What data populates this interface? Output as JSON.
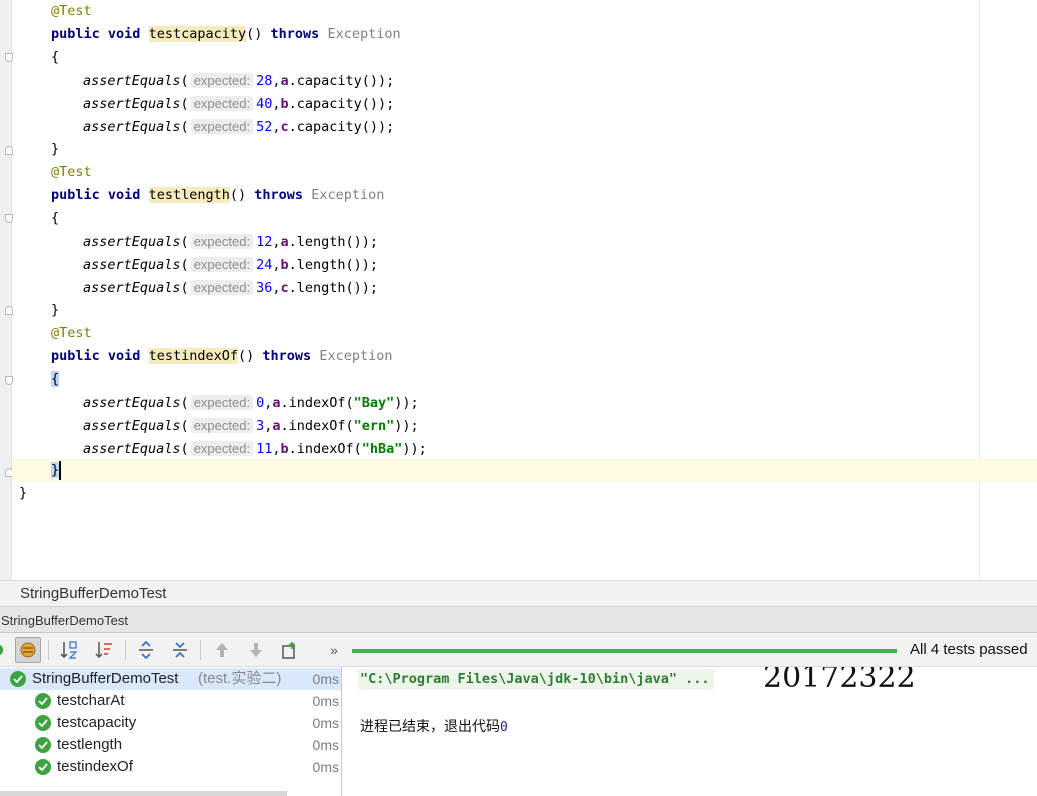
{
  "editor": {
    "lines": {
      "l0": {
        "annotation": "@Test"
      },
      "l1": {
        "public": "public",
        "void": "void",
        "method": "testcapacity",
        "paren": "()",
        "throws": "throws",
        "exception": "Exception"
      },
      "l2": {
        "brace": "{"
      },
      "l3": {
        "call": "assertEquals",
        "open": "(",
        "hint": "expected:",
        "value": "28",
        "obj": "a",
        "rest": ".capacity());"
      },
      "l4": {
        "call": "assertEquals",
        "open": "(",
        "hint": "expected:",
        "value": "40",
        "obj": "b",
        "rest": ".capacity());"
      },
      "l5": {
        "call": "assertEquals",
        "open": "(",
        "hint": "expected:",
        "value": "52",
        "obj": "c",
        "rest": ".capacity());"
      },
      "l6": {
        "brace": "}"
      },
      "l7": {
        "annotation": "@Test"
      },
      "l8": {
        "public": "public",
        "void": "void",
        "method": "testlength",
        "paren": "()",
        "throws": "throws",
        "exception": "Exception"
      },
      "l9": {
        "brace": "{"
      },
      "l10": {
        "call": "assertEquals",
        "open": "(",
        "hint": "expected:",
        "value": "12",
        "obj": "a",
        "rest": ".length());"
      },
      "l11": {
        "call": "assertEquals",
        "open": "(",
        "hint": "expected:",
        "value": "24",
        "obj": "b",
        "rest": ".length());"
      },
      "l12": {
        "call": "assertEquals",
        "open": "(",
        "hint": "expected:",
        "value": "36",
        "obj": "c",
        "rest": ".length());"
      },
      "l13": {
        "brace": "}"
      },
      "l14": {
        "annotation": "@Test"
      },
      "l15": {
        "public": "public",
        "void": "void",
        "method": "testindexOf",
        "paren": "()",
        "throws": "throws",
        "exception": "Exception"
      },
      "l16": {
        "brace": "{"
      },
      "l17": {
        "call": "assertEquals",
        "open": "(",
        "hint": "expected:",
        "value": "0",
        "obj": "a",
        "mid": ".indexOf(",
        "str": "\"Bay\"",
        "close": "));"
      },
      "l18": {
        "call": "assertEquals",
        "open": "(",
        "hint": "expected:",
        "value": "3",
        "obj": "a",
        "mid": ".indexOf(",
        "str": "\"ern\"",
        "close": "));"
      },
      "l19": {
        "call": "assertEquals",
        "open": "(",
        "hint": "expected:",
        "value": "11",
        "obj": "b",
        "mid": ".indexOf(",
        "str": "\"hBa\"",
        "close": "));"
      },
      "l20": {
        "brace": "}"
      },
      "l21": {
        "brace": "}"
      }
    }
  },
  "run": {
    "header_title": "StringBufferDemoTest",
    "tab_label": "StringBufferDemoTest",
    "more_label": "»",
    "status": "All 4 tests passed"
  },
  "tree": {
    "root": {
      "name": "StringBufferDemoTest",
      "sub": "(test.实验二)",
      "time": "0ms"
    },
    "items": [
      {
        "name": "testcharAt",
        "time": "0ms"
      },
      {
        "name": "testcapacity",
        "time": "0ms"
      },
      {
        "name": "testlength",
        "time": "0ms"
      },
      {
        "name": "testindexOf",
        "time": "0ms"
      }
    ]
  },
  "console": {
    "command": "\"C:\\Program Files\\Java\\jdk-10\\bin\\java\" ...",
    "overlay_text": "20172322",
    "exit_message": "进程已结束，退出代码",
    "exit_code": "0"
  },
  "colors": {
    "pass_green": "#3da341",
    "progress_green": "#3bb54a",
    "keyword_navy": "#000080",
    "annotation_olive": "#808000",
    "number_blue": "#0000ff",
    "field_purple": "#660e7a",
    "string_green": "#008000"
  }
}
